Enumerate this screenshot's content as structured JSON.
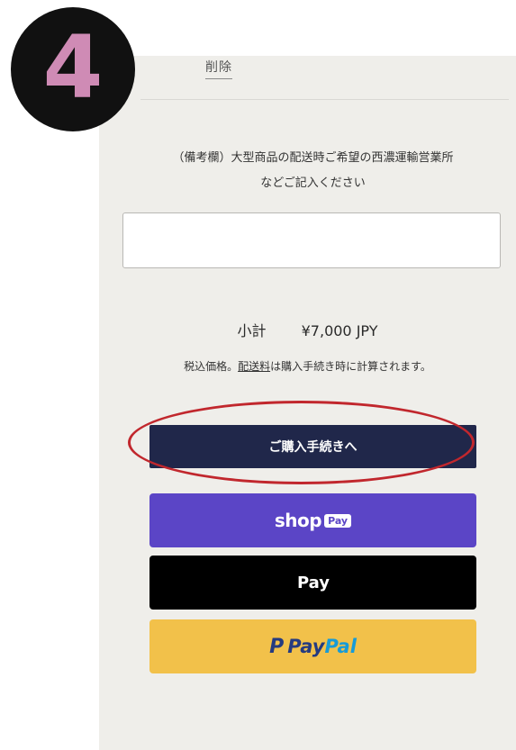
{
  "step": {
    "number": "4"
  },
  "cart": {
    "delete_label": "削除",
    "note_label": "（備考欄）大型商品の配送時ご希望の西濃運輸営業所\nなどご記入ください",
    "note_value": "",
    "subtotal_label": "小計",
    "subtotal_value": "¥7,000 JPY",
    "tax_prefix": "税込価格。",
    "tax_link": "配送料",
    "tax_suffix": "は購入手続き時に計算されます。"
  },
  "buttons": {
    "checkout": "ご購入手続きへ",
    "shop_pay_text": "shop",
    "shop_pay_pill": "Pay",
    "apple_logo": "",
    "apple_pay_text": "Pay",
    "paypal_p": "P",
    "paypal_pay": "Pay",
    "paypal_pal": "Pal"
  },
  "colors": {
    "checkout_bg": "#20274a",
    "shop_pay_bg": "#5b45c6",
    "apple_pay_bg": "#000000",
    "paypal_bg": "#f2c14a",
    "highlight": "#c1272d"
  }
}
